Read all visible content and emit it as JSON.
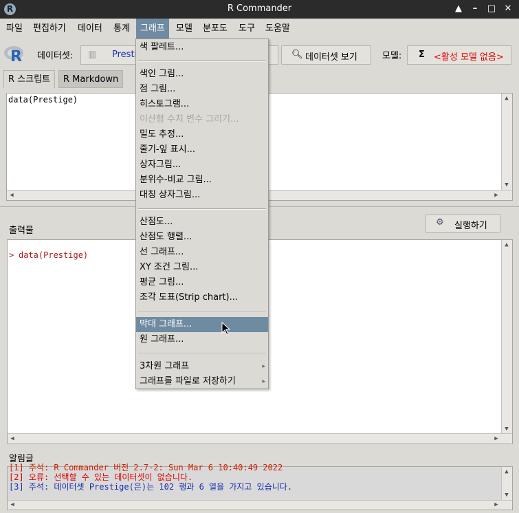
{
  "window": {
    "title": "R Commander",
    "icon": "r-logo-icon"
  },
  "window_controls": [
    "▲",
    "–",
    "□",
    "✕"
  ],
  "menubar": {
    "items": [
      "파일",
      "편집하기",
      "데이터",
      "통계",
      "그래프",
      "모델",
      "분포도",
      "도구",
      "도움말"
    ],
    "active": "그래프"
  },
  "toolbar": {
    "dataset_label": "데이터셋:",
    "dataset_value": "Presti",
    "view_dataset_label": "데이터셋 보기",
    "model_label": "모델:",
    "model_sigma": "Σ",
    "model_value": "<활성 모델 없음>"
  },
  "tabs": {
    "script": "R 스크립트",
    "markdown": "R Markdown"
  },
  "script": {
    "text": "data(Prestige)"
  },
  "output": {
    "label": "출력물",
    "run_label": "실행하기",
    "prompt": ">",
    "line": "data(Prestige)"
  },
  "messages": {
    "label": "알림글",
    "lines": [
      {
        "text": "[1] 주석: R Commander 버전 2.7-2: Sun Mar 6 10:40:49 2022",
        "color": "#cc2200"
      },
      {
        "text": "[2] 오류: 선택할 수 있는 데이터셋이 없습니다.",
        "color": "#e00000"
      },
      {
        "text": "[3] 주석: 데이터셋 Prestige(은)는 102 행과 6 열을 가지고 있습니다.",
        "color": "#1a2fb0"
      }
    ]
  },
  "graph_menu": {
    "items": [
      {
        "label": "색 팔레트...",
        "state": "normal"
      },
      {
        "label": "색인 그림...",
        "state": "normal"
      },
      {
        "label": "점 그림...",
        "state": "normal"
      },
      {
        "label": "히스토그램...",
        "state": "normal"
      },
      {
        "label": "이산형 수치 변수 그리기...",
        "state": "disabled"
      },
      {
        "label": "밀도 추정...",
        "state": "normal"
      },
      {
        "label": "줄기-잎 표시...",
        "state": "normal"
      },
      {
        "label": "상자그림...",
        "state": "normal"
      },
      {
        "label": "분위수-비교 그림...",
        "state": "normal"
      },
      {
        "label": "대칭 상자그림...",
        "state": "normal"
      },
      {
        "label": "산점도...",
        "state": "normal"
      },
      {
        "label": "산점도 행렬...",
        "state": "normal"
      },
      {
        "label": "선 그래프...",
        "state": "normal"
      },
      {
        "label": "XY 조건 그림...",
        "state": "normal"
      },
      {
        "label": "평균 그림...",
        "state": "normal"
      },
      {
        "label": "조각 도표(Strip chart)...",
        "state": "normal"
      },
      {
        "label": "막대 그래프...",
        "state": "highlighted"
      },
      {
        "label": "원 그래프...",
        "state": "normal"
      },
      {
        "label": "3차원 그래프",
        "state": "submenu"
      },
      {
        "label": "그래프를 파일로 저장하기",
        "state": "submenu"
      }
    ]
  },
  "colors": {
    "highlight": "#6f8ba1",
    "background": "#dcdad5",
    "titlebar": "#2b2b2b"
  }
}
